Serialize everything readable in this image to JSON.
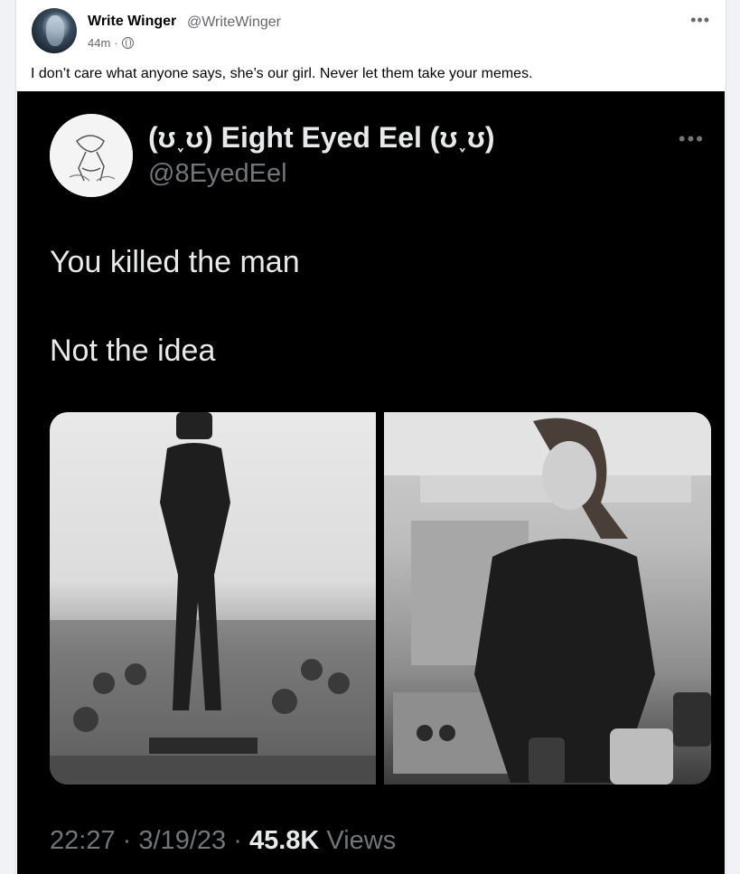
{
  "post": {
    "author_name": "Write Winger",
    "author_handle": "@WriteWinger",
    "time": "44m",
    "separator": "·",
    "more_label": "•••",
    "caption": "I don’t care what anyone says, she’s our girl. Never let them take your memes."
  },
  "tweet": {
    "display_name": "(ʊ˯ʊ) Eight Eyed Eel (ʊ˯ʊ)",
    "handle": "@8EyedEel",
    "more_label": "•••",
    "line1": "You killed the man",
    "line2": "Not the idea",
    "time": "22:27",
    "date": "3/19/23",
    "views_count": "45.8K",
    "views_label": "Views",
    "dot": "·"
  },
  "colors": {
    "page_bg": "#f0f2f5",
    "tweet_bg": "#000000",
    "tweet_text": "#e7e9ea",
    "tweet_muted": "#71767b"
  }
}
